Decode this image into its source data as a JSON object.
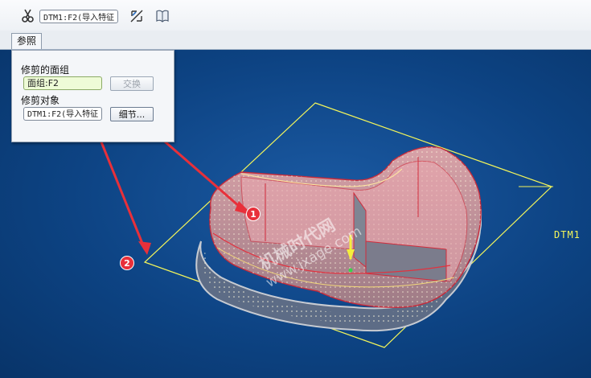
{
  "toolbar": {
    "reference_value": "DTM1:F2(导入特征",
    "icons": [
      "scissors-icon",
      "flip-direction-icon",
      "book-icon"
    ]
  },
  "tabs": [
    {
      "label": "参照"
    }
  ],
  "references_panel": {
    "trimmed_quilt_label": "修剪的面组",
    "trimmed_quilt_value": "面组:F2",
    "swap_button": "交换",
    "trimming_object_label": "修剪对象",
    "trimming_object_value": "DTM1:F2(导入特征",
    "details_button": "细节..."
  },
  "viewport": {
    "datum_plane_label": "DTM1",
    "watermark_title": "机械时代网",
    "watermark_url": "www.jxage.com"
  },
  "callouts": [
    "1",
    "2"
  ],
  "colors": {
    "viewport_bg": "#0e3f79",
    "datum_plane": "#f3f55a",
    "callout": "#e8303a"
  }
}
